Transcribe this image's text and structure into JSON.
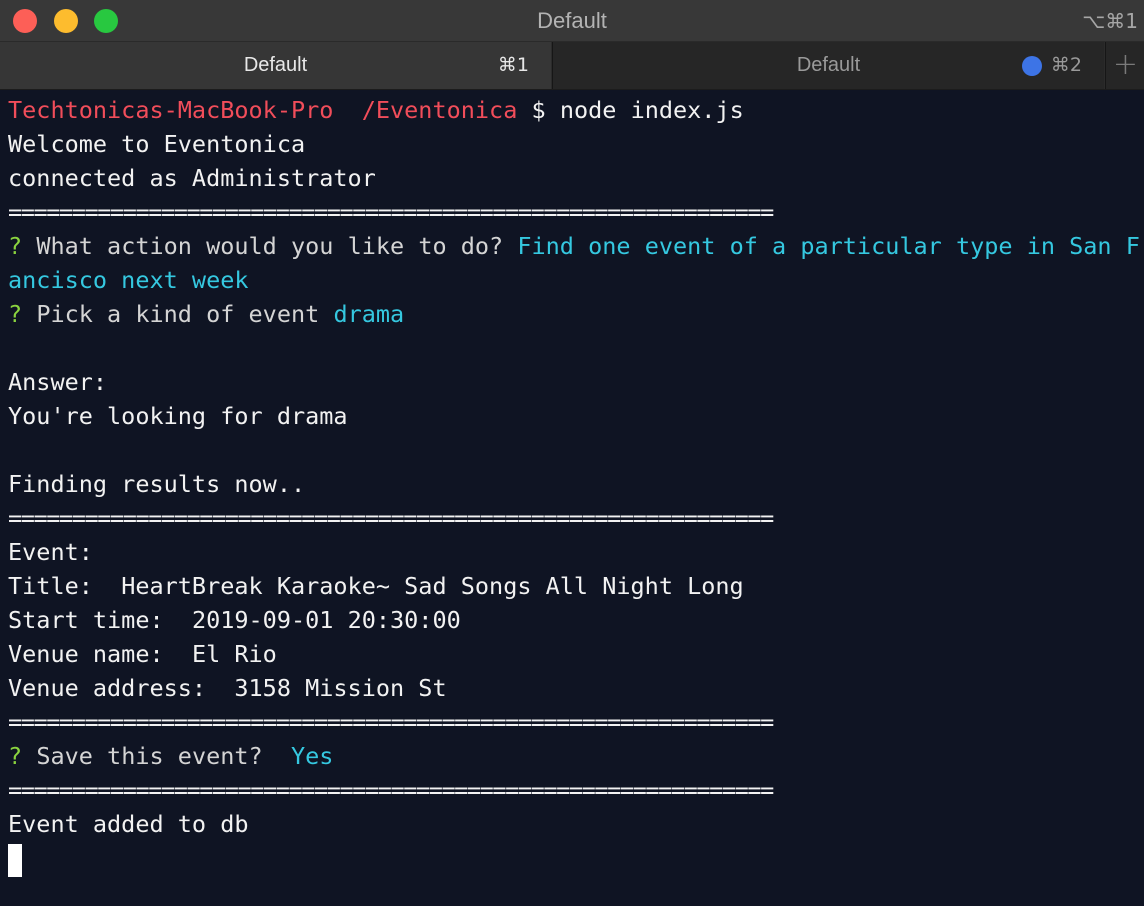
{
  "window": {
    "title": "Default",
    "shortcut": "⌥⌘1"
  },
  "tabs": [
    {
      "label": "Default",
      "shortcut": "⌘1"
    },
    {
      "label": "Default",
      "shortcut": "⌘2"
    }
  ],
  "new_tab_icon": "plus-icon",
  "colors": {
    "prompt": "#f14d5a",
    "question_mark": "#8bd43f",
    "answer": "#35c8e0",
    "background": "#0f1423"
  },
  "terminal": {
    "prompt_host": "Techtonicas-MacBook-Pro",
    "prompt_path": "/Eventonica",
    "prompt_symbol": "$",
    "command": "node index.js",
    "welcome": "Welcome to Eventonica",
    "connected": "connected as Administrator",
    "rule": "============================================================",
    "q1_mark": "?",
    "q1_text": "What action would you like to do?",
    "q1_answer_part1": "Find one event of a particular type in San Fr",
    "q1_answer_part2": "ancisco next week",
    "q2_mark": "?",
    "q2_text": "Pick a kind of event",
    "q2_answer": "drama",
    "answer_label": "Answer:",
    "looking_for": "You're looking for drama",
    "finding": "Finding results now..",
    "event_label": "Event:",
    "title_label": "Title:",
    "title_value": "HeartBreak Karaoke~ Sad Songs All Night Long",
    "start_label": "Start time:",
    "start_value": "2019-09-01 20:30:00",
    "venue_label": "Venue name:",
    "venue_value": "El Rio",
    "address_label": "Venue address:",
    "address_value": "3158 Mission St",
    "q3_mark": "?",
    "q3_text": "Save this event?",
    "q3_answer": "Yes",
    "added": "Event added to db"
  }
}
